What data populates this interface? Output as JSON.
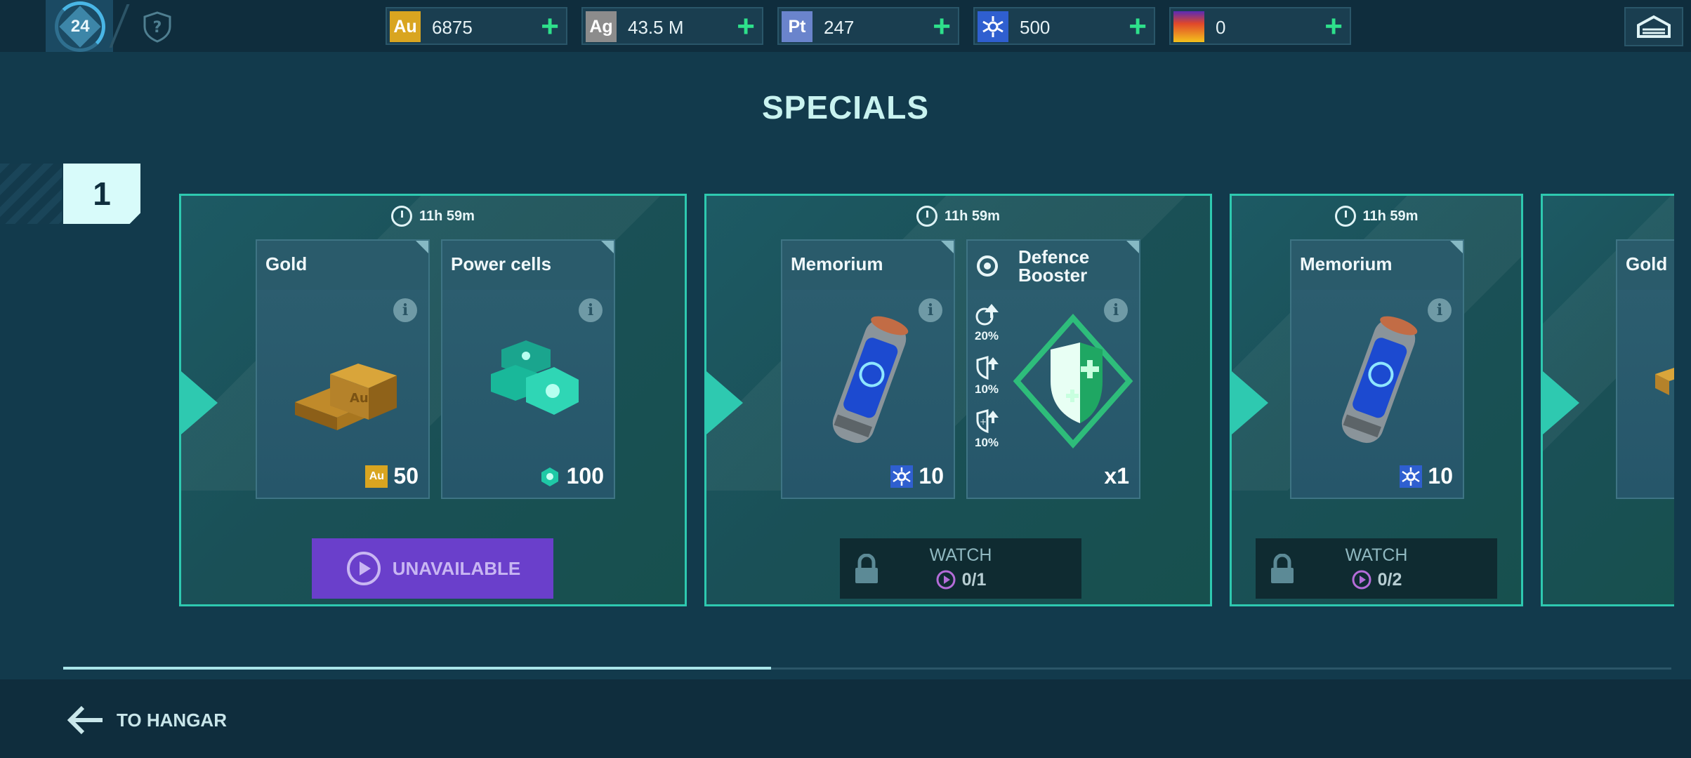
{
  "header": {
    "level": "24",
    "resources": [
      {
        "code": "Au",
        "value": "6875",
        "color": "#d9a520",
        "icon": "gold-icon"
      },
      {
        "code": "Ag",
        "value": "43.5 M",
        "color": "#8c8c8c",
        "icon": "silver-icon"
      },
      {
        "code": "Pt",
        "value": "247",
        "color": "#6a84cc",
        "icon": "platinum-icon"
      },
      {
        "code": "",
        "value": "500",
        "color": "#2f5fd0",
        "icon": "memorium-icon"
      },
      {
        "code": "",
        "value": "0",
        "color": "#e0482a",
        "icon": "fire-icon"
      }
    ],
    "add_symbol": "+"
  },
  "title": "SPECIALS",
  "tier": "1",
  "offers": [
    {
      "timer": "11h 59m",
      "items": [
        {
          "name": "Gold",
          "info": "i",
          "qty": "50",
          "currency_icon": "Au"
        },
        {
          "name": "Power cells",
          "info": "i",
          "qty": "100"
        }
      ],
      "button": "UNAVAILABLE"
    },
    {
      "timer": "11h 59m",
      "items": [
        {
          "name": "Memorium",
          "info": "i",
          "qty": "10"
        },
        {
          "name": "Defence Booster",
          "info": "i",
          "qty": "x1",
          "stats": [
            "20%",
            "10%",
            "10%"
          ]
        }
      ],
      "button": {
        "label": "WATCH",
        "count": "0/1"
      }
    },
    {
      "timer": "11h 59m",
      "items": [
        {
          "name": "Memorium",
          "info": "i",
          "qty": "10"
        }
      ],
      "button": {
        "label": "WATCH",
        "count": "0/2"
      }
    },
    {
      "items": [
        {
          "name": "Gold"
        }
      ]
    }
  ],
  "scroll_progress": 0.44,
  "footer": {
    "back_label": "TO HANGAR"
  },
  "colors": {
    "accent": "#2ec9b0",
    "plus": "#2ee08b",
    "purple_button": "#6a3fcb"
  }
}
